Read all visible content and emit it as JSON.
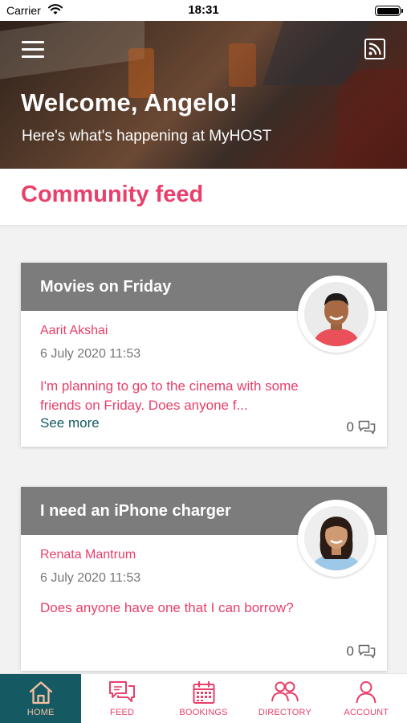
{
  "status_bar": {
    "carrier": "Carrier",
    "time": "18:31"
  },
  "header": {
    "title": "Welcome, Angelo!",
    "subtitle": "Here's what's happening at MyHOST",
    "menu_icon": "hamburger-menu-icon",
    "feed_icon": "rss-feed-icon"
  },
  "section": {
    "title": "Community feed"
  },
  "posts": [
    {
      "title": "Movies on Friday",
      "author": "Aarit Akshai",
      "date": "6 July 2020 11:53",
      "body": "I'm planning to go to the cinema with some friends on Friday. Does anyone f...",
      "see_more": "See more",
      "comment_count": "0"
    },
    {
      "title": "I need an iPhone charger",
      "author": "Renata Mantrum",
      "date": "6 July 2020 11:53",
      "body": "Does anyone have one that I can borrow?",
      "see_more": "",
      "comment_count": "0"
    }
  ],
  "tabs": [
    {
      "label": "HOME",
      "icon": "home-icon",
      "active": true
    },
    {
      "label": "FEED",
      "icon": "chat-bubbles-icon",
      "active": false
    },
    {
      "label": "BOOKINGS",
      "icon": "calendar-icon",
      "active": false
    },
    {
      "label": "DIRECTORY",
      "icon": "people-icon",
      "active": false
    },
    {
      "label": "ACCOUNT",
      "icon": "person-icon",
      "active": false
    }
  ],
  "colors": {
    "accent": "#e93f6a",
    "active_tab": "#155a63",
    "card_header": "#7c7c7c",
    "see_more": "#155a63"
  }
}
